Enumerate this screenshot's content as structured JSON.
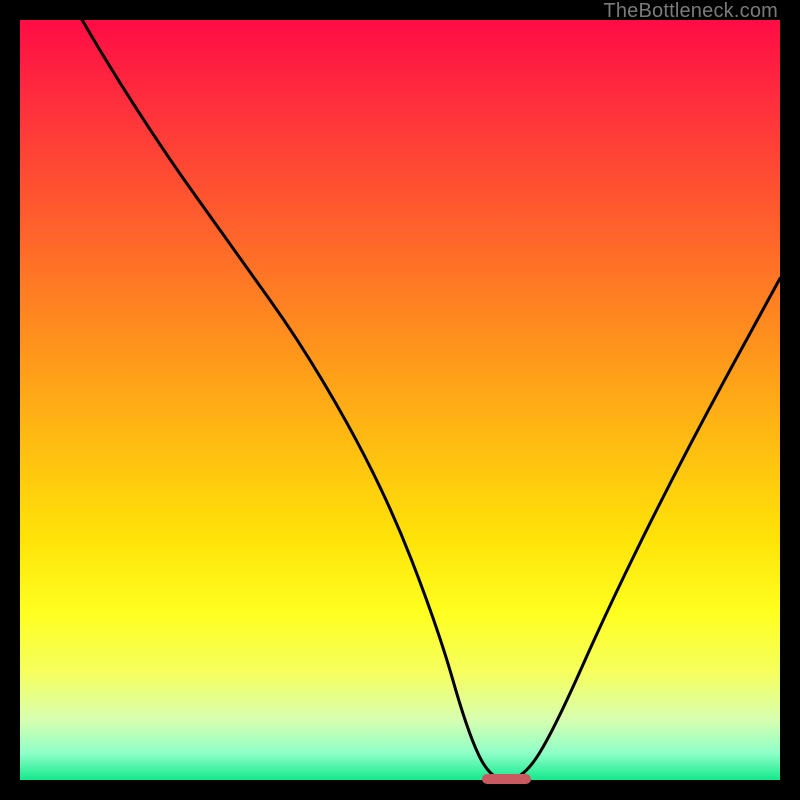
{
  "watermark": "TheBottleneck.com",
  "colors": {
    "line": "#000000",
    "marker": "#c95a5f",
    "gradient_stops": [
      {
        "offset": 0.0,
        "color": "#ff0c45"
      },
      {
        "offset": 0.1,
        "color": "#ff2c3d"
      },
      {
        "offset": 0.25,
        "color": "#ff5a2e"
      },
      {
        "offset": 0.4,
        "color": "#ff8a1f"
      },
      {
        "offset": 0.55,
        "color": "#ffba12"
      },
      {
        "offset": 0.68,
        "color": "#ffe208"
      },
      {
        "offset": 0.78,
        "color": "#ffff20"
      },
      {
        "offset": 0.86,
        "color": "#f5ff60"
      },
      {
        "offset": 0.92,
        "color": "#d8ffb0"
      },
      {
        "offset": 0.965,
        "color": "#8effc8"
      },
      {
        "offset": 1.0,
        "color": "#14e98c"
      }
    ]
  },
  "chart_data": {
    "type": "line",
    "title": "",
    "xlabel": "",
    "ylabel": "",
    "xlim": [
      0,
      100
    ],
    "ylim": [
      0,
      100
    ],
    "x": [
      0,
      8,
      18,
      28,
      38,
      48,
      55,
      59,
      62,
      66,
      70,
      78,
      88,
      100
    ],
    "values": [
      115,
      100,
      84,
      70,
      56,
      38,
      20,
      6,
      0,
      0,
      6,
      24,
      44,
      66
    ],
    "marker": {
      "x_start": 61,
      "x_end": 67,
      "y": 0
    },
    "notes": "V-shaped bottleneck curve; values are percentage distance from optimal (0 = best). Axes unlabeled in source image; x normalized 0–100 left→right, y normalized 0–100 bottom→top. First point exceeds ylim (line enters from top)."
  }
}
